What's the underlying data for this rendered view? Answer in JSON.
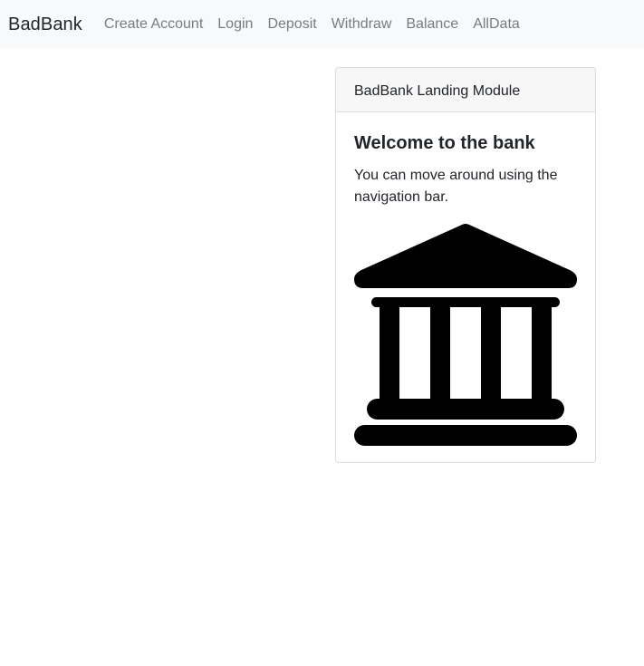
{
  "navbar": {
    "brand": "BadBank",
    "links": [
      {
        "label": "Create Account"
      },
      {
        "label": "Login"
      },
      {
        "label": "Deposit"
      },
      {
        "label": "Withdraw"
      },
      {
        "label": "Balance"
      },
      {
        "label": "AllData"
      }
    ]
  },
  "card": {
    "header": "BadBank Landing Module",
    "title": "Welcome to the bank",
    "text": "You can move around using the navigation bar.",
    "image_icon": "bank-building-icon"
  },
  "colors": {
    "navbar_bg": "#f8f9fa",
    "nav_link": "#7a7b7d",
    "text": "#212529",
    "icon": "#000000"
  }
}
